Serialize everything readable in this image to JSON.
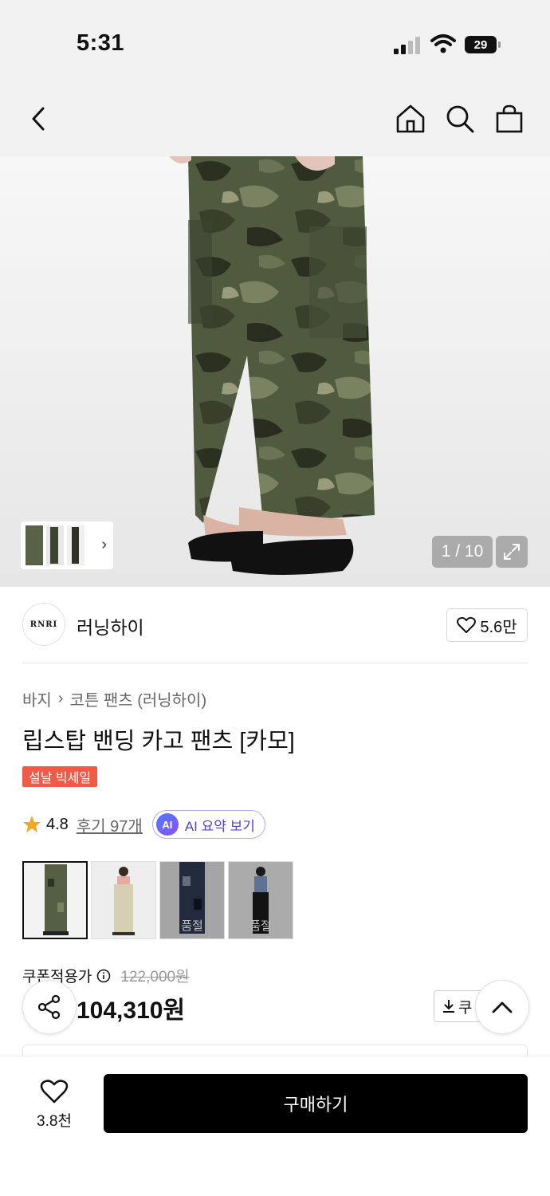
{
  "status_bar": {
    "time": "5:31",
    "battery": "29"
  },
  "nav": {
    "icons": [
      "back-icon",
      "home-icon",
      "search-icon",
      "shopping-bag-icon"
    ]
  },
  "gallery": {
    "page_indicator": "1 / 10",
    "current_page": 1,
    "total_pages": 10
  },
  "brand": {
    "logo_text": "RNRI",
    "name": "러닝하이",
    "likes": "5.6만"
  },
  "breadcrumb": {
    "category": "바지",
    "subcategory": "코튼 팬츠 (러닝하이)"
  },
  "product": {
    "title": "립스탑 밴딩 카고 팬츠 [카모]",
    "badge": "설날 빅세일",
    "rating": "4.8",
    "reviews": "후기 97개",
    "ai_summary": "AI 요약 보기",
    "ai_chip": "AI"
  },
  "variants": [
    {
      "soldout": ""
    },
    {
      "soldout": ""
    },
    {
      "soldout": "품절"
    },
    {
      "soldout": "품절"
    }
  ],
  "price": {
    "label": "쿠폰적용가",
    "original": "122,000원",
    "sale": "104,310원",
    "coupon_label": "쿠"
  },
  "bottom": {
    "wish_count": "3.8천",
    "buy_label": "구매하기"
  },
  "colors": {
    "accent": "#f15a47",
    "ai_purple": "#5a3fd6",
    "buy": "#000000"
  }
}
